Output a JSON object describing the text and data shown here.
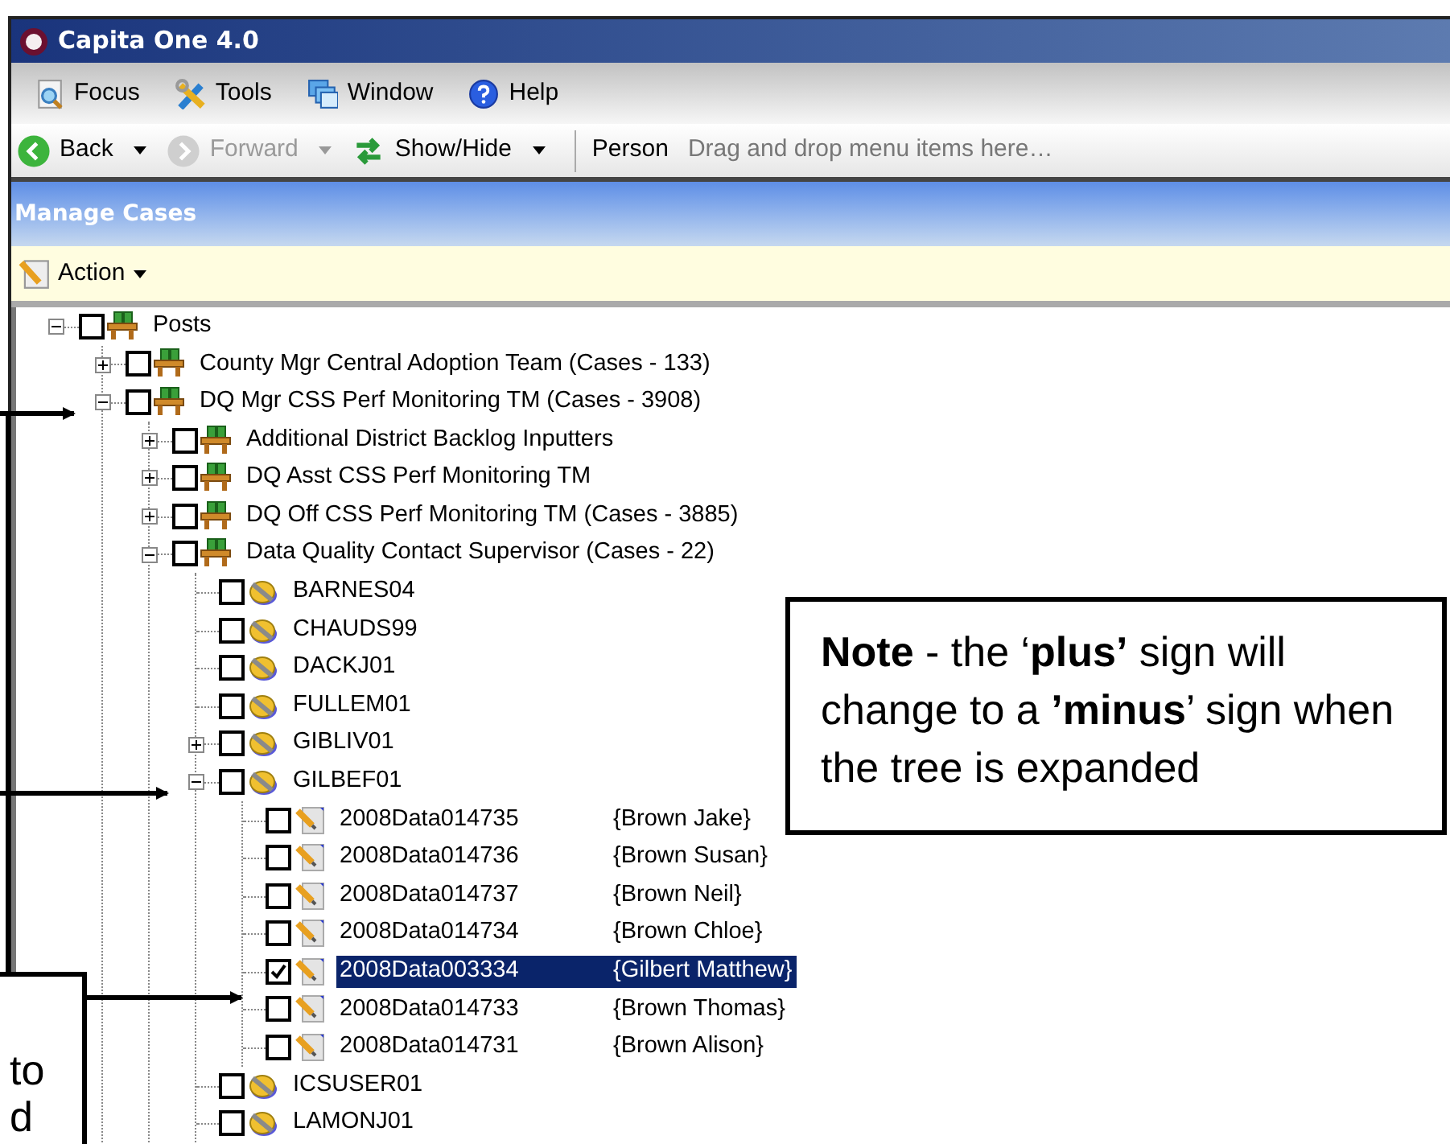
{
  "window": {
    "title": "Capita One 4.0"
  },
  "menu": [
    {
      "label": "Focus"
    },
    {
      "label": "Tools"
    },
    {
      "label": "Window"
    },
    {
      "label": "Help"
    }
  ],
  "toolbar": [
    {
      "kind": "dropdown",
      "label": "Back",
      "disabled": false
    },
    {
      "kind": "dropdown",
      "label": "Forward",
      "disabled": true
    },
    {
      "kind": "dropdown",
      "label": "Show/Hide",
      "disabled": false
    },
    {
      "kind": "plain",
      "label": "Person",
      "disabled": false
    }
  ],
  "toolbar_hint": "Drag and drop menu items here…",
  "panel": {
    "title": "Manage Cases",
    "action": "Action"
  },
  "tree": [
    {
      "kind": "post",
      "label": "Posts",
      "expanded": true,
      "checked": false,
      "selected": false,
      "children": [
        {
          "kind": "post",
          "label": "County Mgr Central Adoption Team (Cases - 133)",
          "expanded": false,
          "checked": false,
          "selected": false
        },
        {
          "kind": "post",
          "label": "DQ Mgr CSS Perf Monitoring TM (Cases - 3908)",
          "expanded": true,
          "checked": false,
          "selected": false,
          "children": [
            {
              "kind": "post",
              "label": "Additional District Backlog Inputters",
              "expanded": false,
              "checked": false,
              "selected": false
            },
            {
              "kind": "post",
              "label": "DQ Asst CSS Perf Monitoring TM",
              "expanded": false,
              "checked": false,
              "selected": false
            },
            {
              "kind": "post",
              "label": "DQ Off CSS Perf Monitoring TM (Cases - 3885)",
              "expanded": false,
              "checked": false,
              "selected": false
            },
            {
              "kind": "post",
              "label": "Data Quality Contact Supervisor  (Cases - 22)",
              "expanded": true,
              "checked": false,
              "selected": false,
              "children": [
                {
                  "kind": "user",
                  "label": "BARNES04",
                  "checked": false,
                  "selected": false
                },
                {
                  "kind": "user",
                  "label": "CHAUDS99",
                  "checked": false,
                  "selected": false
                },
                {
                  "kind": "user",
                  "label": "DACKJ01",
                  "checked": false,
                  "selected": false
                },
                {
                  "kind": "user",
                  "label": "FULLEM01",
                  "checked": false,
                  "selected": false
                },
                {
                  "kind": "user",
                  "label": "GIBLIV01",
                  "expanded": false,
                  "checked": false,
                  "selected": false
                },
                {
                  "kind": "user",
                  "label": "GILBEF01",
                  "expanded": true,
                  "checked": false,
                  "selected": false,
                  "children": [
                    {
                      "kind": "case",
                      "label": "2008Data014735",
                      "name": "{Brown Jake}",
                      "checked": false,
                      "selected": false
                    },
                    {
                      "kind": "case",
                      "label": "2008Data014736",
                      "name": "{Brown Susan}",
                      "checked": false,
                      "selected": false
                    },
                    {
                      "kind": "case",
                      "label": "2008Data014737",
                      "name": "{Brown Neil}",
                      "checked": false,
                      "selected": false
                    },
                    {
                      "kind": "case",
                      "label": "2008Data014734",
                      "name": "{Brown Chloe}",
                      "checked": false,
                      "selected": false
                    },
                    {
                      "kind": "case",
                      "label": "2008Data003334",
                      "name": "{Gilbert Matthew}",
                      "checked": true,
                      "selected": true
                    },
                    {
                      "kind": "case",
                      "label": "2008Data014733",
                      "name": "{Brown Thomas}",
                      "checked": false,
                      "selected": false
                    },
                    {
                      "kind": "case",
                      "label": "2008Data014731",
                      "name": "{Brown Alison}",
                      "checked": false,
                      "selected": false
                    }
                  ]
                },
                {
                  "kind": "user",
                  "label": "ICSUSER01",
                  "checked": false,
                  "selected": false
                },
                {
                  "kind": "user",
                  "label": "LAMONJ01",
                  "checked": false,
                  "selected": false
                }
              ]
            }
          ]
        }
      ]
    }
  ],
  "note": {
    "text": "**Note** - the ‘**plus’** sign will change to a **’minus**’ sign when the tree is expanded"
  },
  "side_note": {
    "lines": [
      "to",
      "d"
    ]
  }
}
